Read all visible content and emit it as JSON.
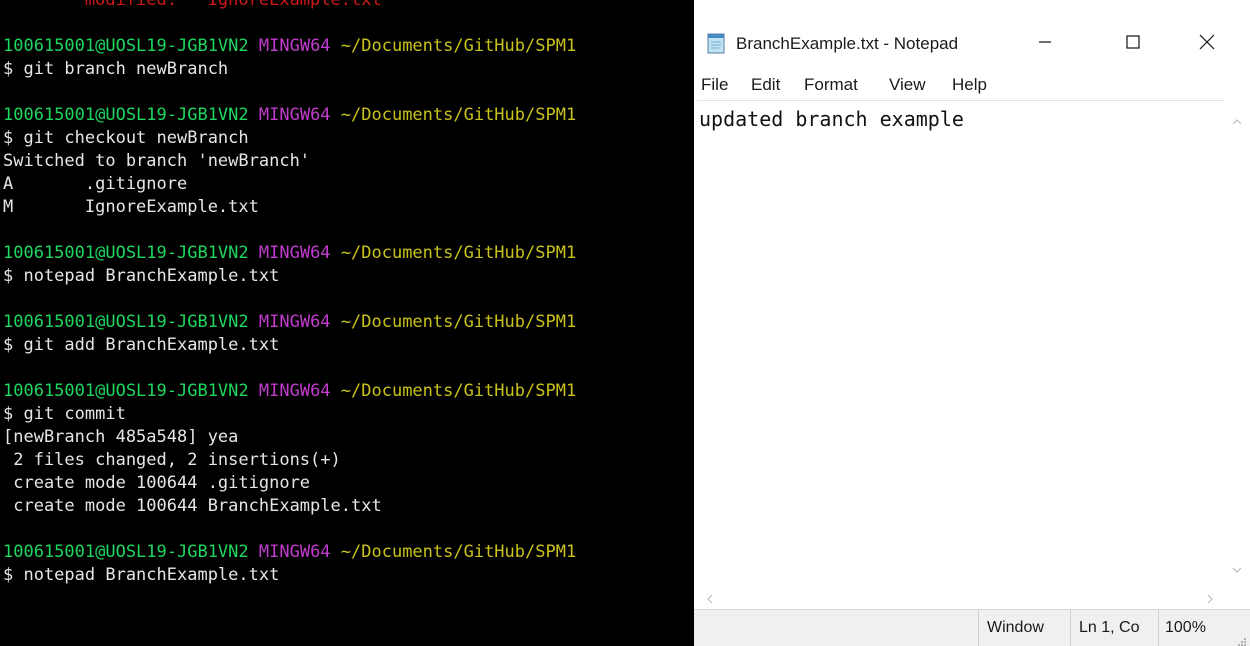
{
  "terminal": {
    "lines": [
      [
        {
          "t": "        modified:   IgnoreExample.txt",
          "c": "red"
        }
      ],
      [
        {
          "t": "",
          "c": "white"
        }
      ],
      [
        {
          "t": "100615001@UOSL19-JGB1VN2",
          "c": "user"
        },
        {
          "t": " ",
          "c": "white"
        },
        {
          "t": "MINGW64",
          "c": "sys"
        },
        {
          "t": " ~/Documents/GitHub/SPM1",
          "c": "path"
        }
      ],
      [
        {
          "t": "$ git branch newBranch",
          "c": "white"
        }
      ],
      [
        {
          "t": "",
          "c": "white"
        }
      ],
      [
        {
          "t": "100615001@UOSL19-JGB1VN2",
          "c": "user"
        },
        {
          "t": " ",
          "c": "white"
        },
        {
          "t": "MINGW64",
          "c": "sys"
        },
        {
          "t": " ~/Documents/GitHub/SPM1",
          "c": "path"
        }
      ],
      [
        {
          "t": "$ git checkout newBranch",
          "c": "white"
        }
      ],
      [
        {
          "t": "Switched to branch 'newBranch'",
          "c": "white"
        }
      ],
      [
        {
          "t": "A       .gitignore",
          "c": "white"
        }
      ],
      [
        {
          "t": "M       IgnoreExample.txt",
          "c": "white"
        }
      ],
      [
        {
          "t": "",
          "c": "white"
        }
      ],
      [
        {
          "t": "100615001@UOSL19-JGB1VN2",
          "c": "user"
        },
        {
          "t": " ",
          "c": "white"
        },
        {
          "t": "MINGW64",
          "c": "sys"
        },
        {
          "t": " ~/Documents/GitHub/SPM1",
          "c": "path"
        }
      ],
      [
        {
          "t": "$ notepad BranchExample.txt",
          "c": "white"
        }
      ],
      [
        {
          "t": "",
          "c": "white"
        }
      ],
      [
        {
          "t": "100615001@UOSL19-JGB1VN2",
          "c": "user"
        },
        {
          "t": " ",
          "c": "white"
        },
        {
          "t": "MINGW64",
          "c": "sys"
        },
        {
          "t": " ~/Documents/GitHub/SPM1",
          "c": "path"
        }
      ],
      [
        {
          "t": "$ git add BranchExample.txt",
          "c": "white"
        }
      ],
      [
        {
          "t": "",
          "c": "white"
        }
      ],
      [
        {
          "t": "100615001@UOSL19-JGB1VN2",
          "c": "user"
        },
        {
          "t": " ",
          "c": "white"
        },
        {
          "t": "MINGW64",
          "c": "sys"
        },
        {
          "t": " ~/Documents/GitHub/SPM1",
          "c": "path"
        }
      ],
      [
        {
          "t": "$ git commit",
          "c": "white"
        }
      ],
      [
        {
          "t": "[newBranch 485a548] yea",
          "c": "white"
        }
      ],
      [
        {
          "t": " 2 files changed, 2 insertions(+)",
          "c": "white"
        }
      ],
      [
        {
          "t": " create mode 100644 .gitignore",
          "c": "white"
        }
      ],
      [
        {
          "t": " create mode 100644 BranchExample.txt",
          "c": "white"
        }
      ],
      [
        {
          "t": "",
          "c": "white"
        }
      ],
      [
        {
          "t": "100615001@UOSL19-JGB1VN2",
          "c": "user"
        },
        {
          "t": " ",
          "c": "white"
        },
        {
          "t": "MINGW64",
          "c": "sys"
        },
        {
          "t": " ~/Documents/GitHub/SPM1",
          "c": "path"
        }
      ],
      [
        {
          "t": "$ notepad BranchExample.txt",
          "c": "white"
        }
      ]
    ],
    "colors": {
      "background": "#000000",
      "user": "#1ed760",
      "sys": "#c23ccf",
      "path": "#c8c21a",
      "red": "#d01818",
      "white": "#e6e6e6"
    }
  },
  "notepad": {
    "title": "BranchExample.txt - Notepad",
    "app_icon": "notepad-icon",
    "window_buttons": {
      "minimize": "minimize-icon",
      "maximize": "maximize-icon",
      "close": "close-icon"
    },
    "menu": {
      "file": "File",
      "edit": "Edit",
      "format": "Format",
      "view": "View",
      "help": "Help"
    },
    "content": "updated branch example",
    "status": {
      "encoding": "Window",
      "position": "Ln 1, Co",
      "zoom": "100%"
    }
  }
}
